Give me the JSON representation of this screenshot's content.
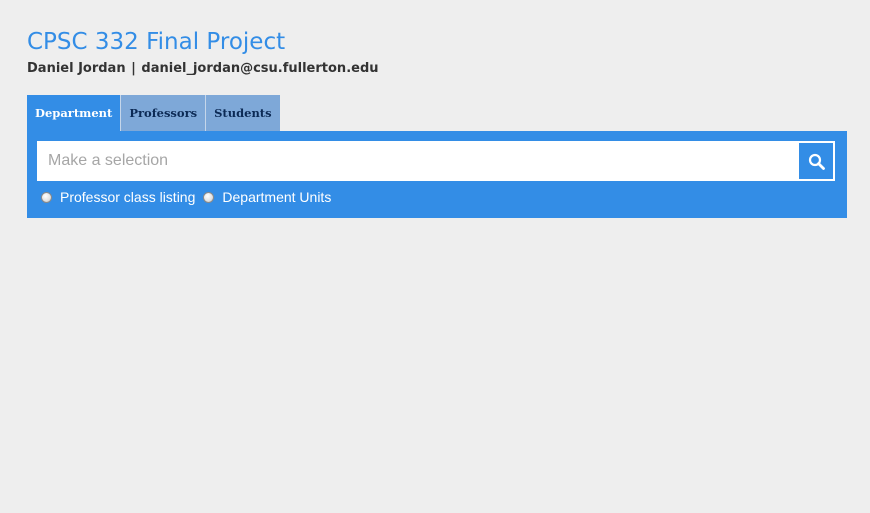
{
  "header": {
    "title": "CPSC 332 Final Project",
    "author": "Daniel Jordan",
    "separator": "|",
    "email": "daniel_jordan@csu.fullerton.edu"
  },
  "tabs": [
    {
      "label": "Department",
      "active": true
    },
    {
      "label": "Professors",
      "active": false
    },
    {
      "label": "Students",
      "active": false
    }
  ],
  "search": {
    "value": "",
    "placeholder": "Make a selection",
    "button_icon": "search-icon"
  },
  "options": [
    {
      "label": "Professor class listing",
      "selected": false
    },
    {
      "label": "Department Units",
      "selected": false
    }
  ],
  "colors": {
    "accent": "#338de6",
    "tab_inactive": "#7ea8d8",
    "tab_inactive_text": "#0c2a55",
    "background": "#eeeeee"
  }
}
